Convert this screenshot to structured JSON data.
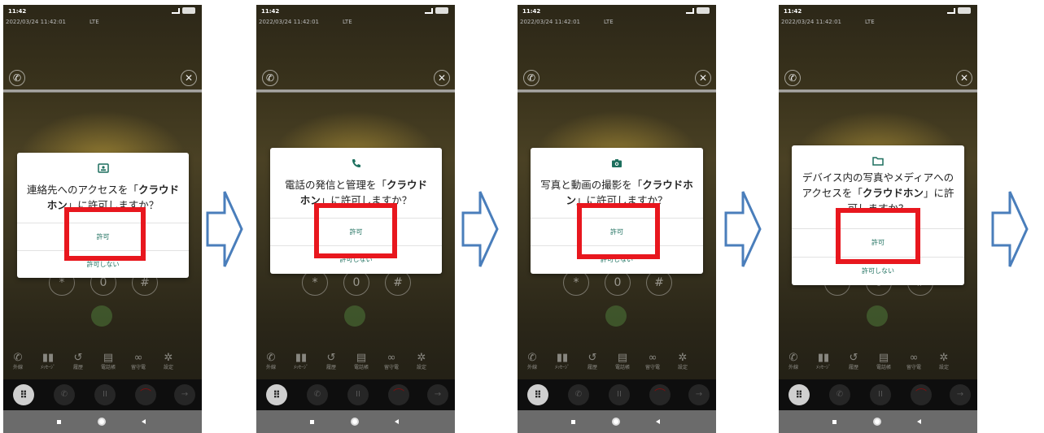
{
  "status": {
    "time": "11:42",
    "timestamp": "2022/03/24 11:42:01",
    "network": "LTE"
  },
  "dialogs": [
    {
      "icon": "contacts-icon",
      "message_prefix": "連絡先へのアクセスを「",
      "app_name": "クラウドホン",
      "message_suffix": "」に許可しますか？",
      "allow_label": "許可",
      "deny_label": "許可しない"
    },
    {
      "icon": "phone-icon",
      "message_prefix": "電話の発信と管理を「",
      "app_name": "クラウドホン",
      "message_suffix": "」に許可しますか？",
      "allow_label": "許可",
      "deny_label": "許可しない"
    },
    {
      "icon": "camera-icon",
      "message_prefix": "写真と動画の撮影を「",
      "app_name": "クラウドホン",
      "message_suffix": "」に許可しますか？",
      "allow_label": "許可",
      "deny_label": "許可しない"
    },
    {
      "icon": "folder-icon",
      "message_prefix": "デバイス内の写真やメディアへのアクセスを「",
      "app_name": "クラウドホン",
      "message_suffix": "」に許可しますか？",
      "allow_label": "許可",
      "deny_label": "許可しない"
    }
  ],
  "bottom_nav": [
    {
      "icon": "phone-icon",
      "label": "外線"
    },
    {
      "icon": "message-icon",
      "label": "ﾒｯｾｰｼﾞ"
    },
    {
      "icon": "history-icon",
      "label": "履歴"
    },
    {
      "icon": "phonebook-icon",
      "label": "電話帳"
    },
    {
      "icon": "voicemail-icon",
      "label": "留守電"
    },
    {
      "icon": "gear-icon",
      "label": "設定"
    }
  ],
  "colors": {
    "dialog_accent": "#1d6f5e",
    "highlight_box": "#e8171e",
    "arrow_stroke": "#4a7ebb"
  }
}
